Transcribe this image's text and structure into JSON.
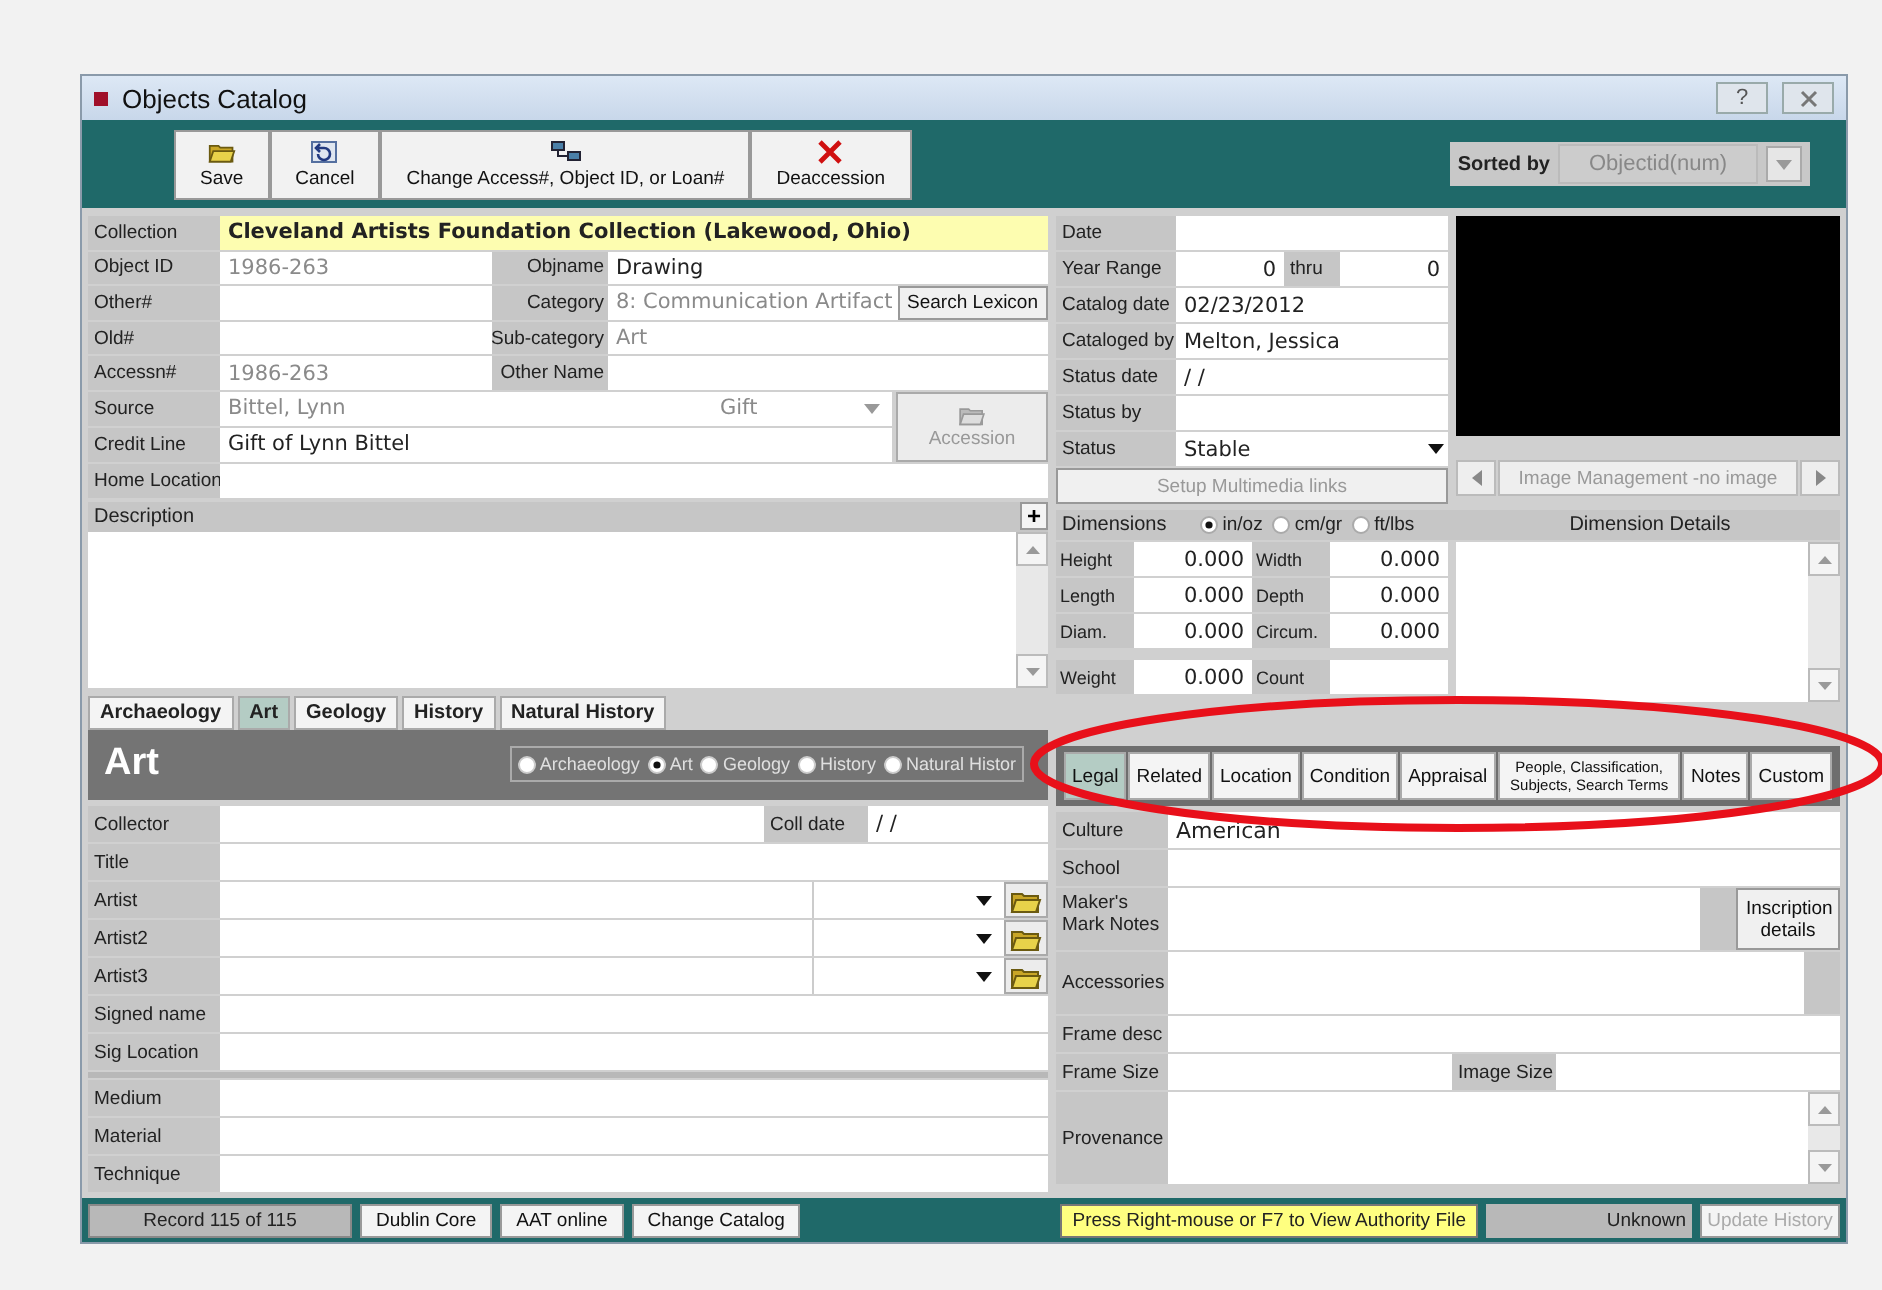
{
  "window": {
    "title": "Objects Catalog",
    "help": "?"
  },
  "toolbar": {
    "buttons": [
      {
        "kind": "save",
        "label": "Save"
      },
      {
        "kind": "cancel",
        "label": "Cancel"
      },
      {
        "kind": "change",
        "label": "Change Access#, Object ID, or Loan#"
      },
      {
        "kind": "deaccession",
        "label": "Deaccession"
      }
    ],
    "sort_label": "Sorted by",
    "sort_value": "Objectid(num)"
  },
  "identity": {
    "collection": {
      "label": "Collection",
      "value": "Cleveland Artists Foundation Collection (Lakewood, Ohio)"
    },
    "rows": [
      {
        "label": "Object ID",
        "value": "1986-263",
        "muted": true,
        "side_label": "Objname",
        "side_value": "Drawing",
        "side_muted": false
      },
      {
        "label": "Other#",
        "side_label": "Category",
        "side_value": "8: Communication Artifact",
        "side_muted": true,
        "button": "Search Lexicon"
      },
      {
        "label": "Old#",
        "side_label": "Sub-category",
        "side_value": "Art",
        "side_muted": true
      },
      {
        "label": "Accessn#",
        "value": "1986-263",
        "muted": true,
        "side_label": "Other Name"
      }
    ],
    "source": {
      "label": "Source",
      "value": "Bittel, Lynn",
      "type": "Gift"
    },
    "credit_line": {
      "label": "Credit Line",
      "value": "Gift of Lynn Bittel"
    },
    "accession_button": "Accession",
    "home_location": {
      "label": "Home Location"
    }
  },
  "description": {
    "label": "Description",
    "add": "+"
  },
  "discipline_tabs": [
    {
      "label": "Archaeology",
      "selected": false
    },
    {
      "label": "Art",
      "selected": true
    },
    {
      "label": "Geology",
      "selected": false
    },
    {
      "label": "History",
      "selected": false
    },
    {
      "label": "Natural History",
      "selected": false
    }
  ],
  "discipline": {
    "title": "Art",
    "options": [
      {
        "label": "Archaeology",
        "selected": false
      },
      {
        "label": "Art",
        "selected": true
      },
      {
        "label": "Geology",
        "selected": false
      },
      {
        "label": "History",
        "selected": false
      },
      {
        "label": "Natural Histor",
        "selected": false
      }
    ]
  },
  "art_fields": [
    {
      "label": "Collector",
      "kind": "date",
      "date_label": "Coll date",
      "date_value": "/  /"
    },
    {
      "label": "Title",
      "kind": "text"
    },
    {
      "label": "Artist",
      "kind": "lookup"
    },
    {
      "label": "Artist2",
      "kind": "lookup"
    },
    {
      "label": "Artist3",
      "kind": "lookup"
    },
    {
      "label": "Signed name",
      "kind": "text"
    },
    {
      "label": "Sig Location",
      "kind": "text"
    }
  ],
  "material_fields": [
    {
      "label": "Medium"
    },
    {
      "label": "Material"
    },
    {
      "label": "Technique"
    }
  ],
  "dating": {
    "rows": [
      {
        "label": "Date",
        "kind": "text"
      },
      {
        "label": "Year Range",
        "kind": "range",
        "value": "0",
        "thru_label": "thru",
        "thru_value": "0"
      },
      {
        "label": "Catalog date",
        "kind": "text",
        "value": "02/23/2012"
      },
      {
        "label": "Cataloged by",
        "kind": "text",
        "value": "Melton, Jessica"
      },
      {
        "label": "Status date",
        "kind": "text",
        "value": "/  /"
      },
      {
        "label": "Status by",
        "kind": "text"
      },
      {
        "label": "Status",
        "kind": "dropdown",
        "value": "Stable"
      }
    ],
    "multimedia_button": "Setup Multimedia links"
  },
  "image": {
    "caption": "Image Management -no image"
  },
  "dimensions": {
    "label": "Dimensions",
    "units": [
      {
        "label": "in/oz",
        "selected": true
      },
      {
        "label": "cm/gr",
        "selected": false
      },
      {
        "label": "ft/lbs",
        "selected": false
      }
    ],
    "details_label": "Dimension Details",
    "rows": [
      [
        {
          "label": "Height",
          "value": "0.000"
        },
        {
          "label": "Width",
          "value": "0.000"
        }
      ],
      [
        {
          "label": "Length",
          "value": "0.000"
        },
        {
          "label": "Depth",
          "value": "0.000"
        }
      ],
      [
        {
          "label": "Diam.",
          "value": "0.000"
        },
        {
          "label": "Circum.",
          "value": "0.000"
        }
      ]
    ],
    "weight": {
      "label": "Weight",
      "value": "0.000"
    },
    "count": {
      "label": "Count"
    }
  },
  "detail_tabs": [
    {
      "label": "Legal",
      "selected": true
    },
    {
      "label": "Related",
      "selected": false
    },
    {
      "label": "Location",
      "selected": false
    },
    {
      "label": "Condition",
      "selected": false
    },
    {
      "label": "Appraisal",
      "selected": false
    },
    {
      "label": "People, Classification, Subjects, Search Terms",
      "selected": false
    },
    {
      "label": "Notes",
      "selected": false
    },
    {
      "label": "Custom",
      "selected": false
    }
  ],
  "legal_fields": [
    {
      "label": "Culture",
      "kind": "text",
      "value": "American"
    },
    {
      "label": "School",
      "kind": "text"
    },
    {
      "label": "Maker's Mark Notes",
      "kind": "button",
      "button": "Inscription details"
    },
    {
      "label": "Accessories",
      "kind": "tall"
    },
    {
      "label": "Frame desc",
      "kind": "text"
    },
    {
      "label": "Frame Size",
      "kind": "pair",
      "side_label": "Image Size"
    },
    {
      "label": "Provenance",
      "kind": "scroll"
    }
  ],
  "status_bar": {
    "record": "Record 115 of 115",
    "buttons": [
      "Dublin Core",
      "AAT online",
      "Change Catalog"
    ],
    "hint": "Press Right-mouse or F7 to View Authority File",
    "status": "Unknown",
    "update_button": "Update History",
    "update_disabled": true
  }
}
